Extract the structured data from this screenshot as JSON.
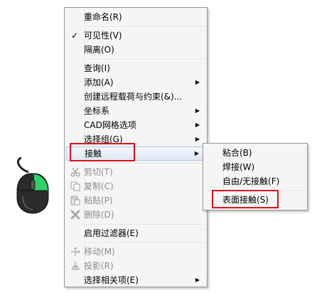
{
  "main_menu": {
    "items": [
      {
        "label": "重命名(R)"
      },
      {
        "label": "可见性(V)",
        "checked": true
      },
      {
        "label": "隔离(O)"
      },
      {
        "label": "查询(I)"
      },
      {
        "label": "添加(A)"
      },
      {
        "label": "创建远程载荷与约束(&)..."
      },
      {
        "label": "坐标系"
      },
      {
        "label": "CAD网格选项"
      },
      {
        "label": "选择组(G)"
      },
      {
        "label": "接触"
      },
      {
        "label": "剪切(T)"
      },
      {
        "label": "复制(C)"
      },
      {
        "label": "粘贴(P)"
      },
      {
        "label": "删除(D)"
      },
      {
        "label": "启用过滤器(E)"
      },
      {
        "label": "移动(M)"
      },
      {
        "label": "投影(R)"
      },
      {
        "label": "选择相关项(E)"
      }
    ],
    "check_glyph": "✓",
    "submenu_arrow": "▶"
  },
  "sub_menu": {
    "items": [
      {
        "label": "粘合(B)"
      },
      {
        "label": "焊接(W)"
      },
      {
        "label": "自由/无接触(F)"
      },
      {
        "label": "表面接触(S)"
      }
    ]
  },
  "icons": {
    "mouse": "mouse-right-click-icon",
    "cut": "scissors-icon",
    "copy": "copy-icon",
    "paste": "paste-icon",
    "delete": "delete-x-icon",
    "move": "move-icon",
    "project": "project-icon"
  },
  "colors": {
    "highlight_border": "#d9121b",
    "mouse_button_active": "#2ed36b",
    "menu_bg": "#f5f5f5"
  }
}
